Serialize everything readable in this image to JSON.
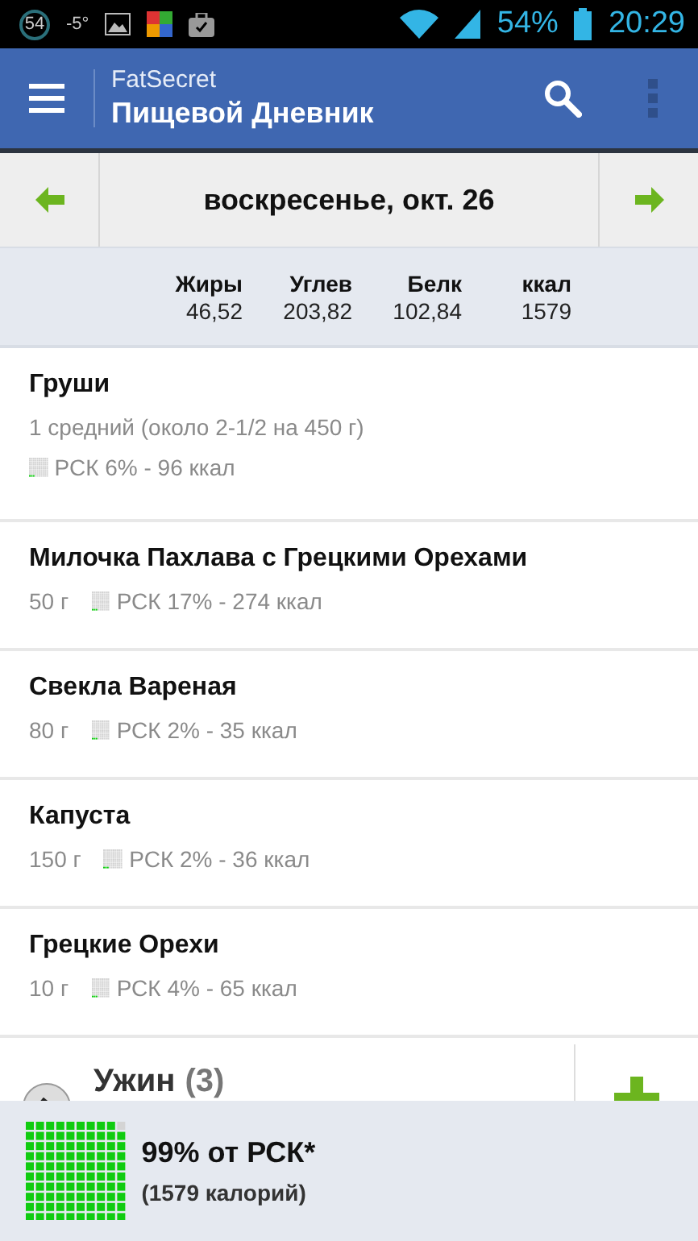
{
  "status_bar": {
    "badge": "54",
    "temperature": "-5°",
    "battery": "54%",
    "time": "20:29"
  },
  "app_bar": {
    "app_name": "FatSecret",
    "title": "Пищевой Дневник"
  },
  "date_nav": {
    "date": "воскресенье, окт. 26"
  },
  "totals": [
    {
      "label": "Жиры",
      "value": "46,52"
    },
    {
      "label": "Углев",
      "value": "203,82"
    },
    {
      "label": "Белк",
      "value": "102,84"
    },
    {
      "label": "ккал",
      "value": "1579"
    }
  ],
  "foods": [
    {
      "name": "Груши",
      "kind": "stacked",
      "serving": "1 средний (около 2-1/2 на 450 г)",
      "rdi": "РСК 6% - 96 ккал"
    },
    {
      "name": "Милочка Пахлава с Грецкими Орехами",
      "kind": "inline",
      "serving": "50 г",
      "rdi": "РСК 17% - 274 ккал"
    },
    {
      "name": "Свекла Вареная",
      "kind": "inline",
      "serving": "80 г",
      "rdi": "РСК 2% - 35 ккал"
    },
    {
      "name": "Капуста",
      "kind": "inline",
      "serving": "150 г",
      "rdi": "РСК 2% - 36 ккал"
    },
    {
      "name": "Грецкие Орехи",
      "kind": "inline",
      "serving": "10 г",
      "rdi": "РСК 4% - 65 ккал"
    }
  ],
  "meal": {
    "name": "Ужин",
    "count": "(3)"
  },
  "summary": {
    "percent": "99% от РСК*",
    "calories": "(1579 калорий)"
  }
}
